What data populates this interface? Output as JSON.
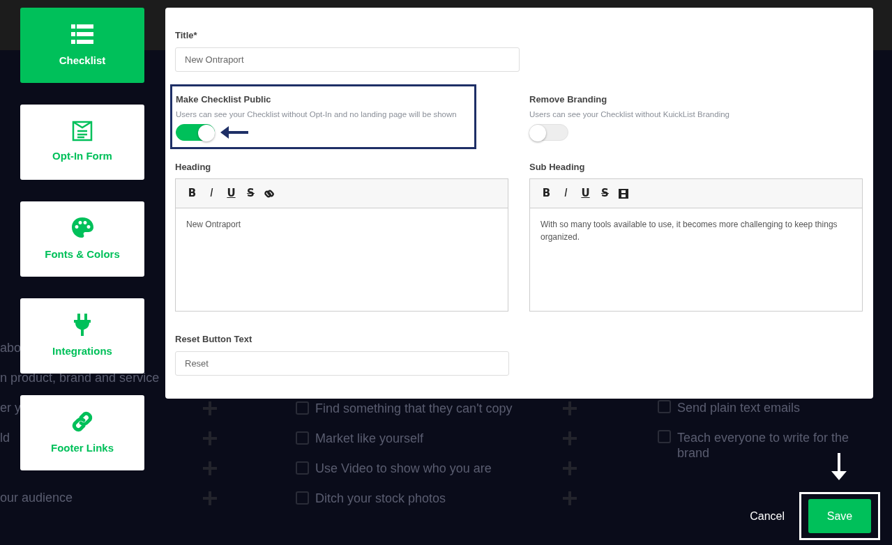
{
  "sidebar": {
    "items": [
      {
        "label": "Checklist",
        "selected": true
      },
      {
        "label": "Opt-In Form",
        "selected": false
      },
      {
        "label": "Fonts & Colors",
        "selected": false
      },
      {
        "label": "Integrations",
        "selected": false
      },
      {
        "label": "Footer Links",
        "selected": false
      }
    ]
  },
  "modal": {
    "title_field": {
      "label": "Title*",
      "value": "New Ontraport"
    },
    "toggles": [
      {
        "label": "Make Checklist Public",
        "description": "Users can see your Checklist without Opt-In and no landing page will be shown",
        "checked": true,
        "highlighted": true
      },
      {
        "label": "Remove Branding",
        "description": "Users can see your Checklist without KuickList Branding",
        "checked": false,
        "highlighted": false
      }
    ],
    "editors": [
      {
        "label": "Heading",
        "tools": [
          "B",
          "I",
          "U",
          "S"
        ],
        "value": "New Ontraport"
      },
      {
        "label": "Sub Heading",
        "tools": [
          "B",
          "I",
          "U",
          "S"
        ],
        "value": "With so many tools available to use, it becomes more challenging to keep things organized."
      }
    ],
    "reset_field": {
      "label": "Reset Button Text",
      "value": "Reset"
    }
  },
  "footer": {
    "cancel": "Cancel",
    "save": "Save",
    "save_highlighted": true
  },
  "background": {
    "rows": [
      {
        "left": "abo"
      },
      {
        "left": "n product, brand and service"
      },
      {
        "left": "er y",
        "middle": {
          "text": "Find something that they can't copy",
          "checked": false
        },
        "right": {
          "text": "Send plain text emails",
          "checked": false
        }
      },
      {
        "left": "ld",
        "middle": {
          "text": "Market like yourself",
          "checked": false
        },
        "right": {
          "text": "Teach everyone to write for the brand",
          "checked": false
        }
      },
      {
        "middle": {
          "text": "Use Video to show who you are",
          "checked": false
        }
      },
      {
        "left": "our audience",
        "middle": {
          "text": "Ditch your stock photos",
          "checked": false
        }
      }
    ]
  }
}
